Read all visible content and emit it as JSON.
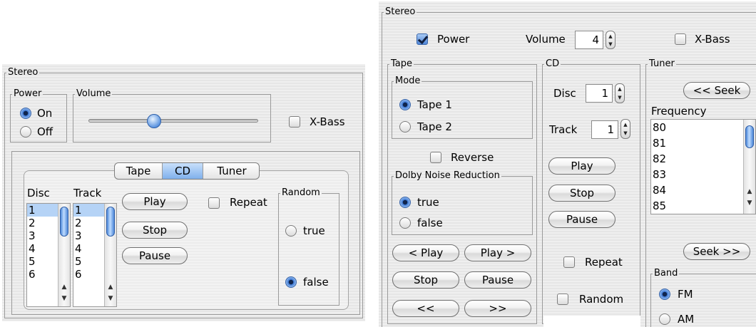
{
  "left": {
    "stereo_title": "Stereo",
    "power": {
      "title": "Power",
      "on_label": "On",
      "off_label": "Off",
      "selected": "On"
    },
    "volume": {
      "title": "Volume",
      "level": 0.45
    },
    "xbass_label": "X-Bass",
    "tabs": [
      {
        "label": "Tape"
      },
      {
        "label": "CD",
        "active": true
      },
      {
        "label": "Tuner"
      }
    ],
    "disc_header": "Disc",
    "track_header": "Track",
    "disc_items": [
      "1",
      "2",
      "3",
      "4",
      "5",
      "6"
    ],
    "track_items": [
      "1",
      "2",
      "3",
      "4",
      "5",
      "6"
    ],
    "play": "Play",
    "stop": "Stop",
    "pause": "Pause",
    "repeat_label": "Repeat",
    "random": {
      "title": "Random",
      "true_label": "true",
      "false_label": "false",
      "selected": "false"
    }
  },
  "right": {
    "stereo_title": "Stereo",
    "power_label": "Power",
    "power_checked": true,
    "volume_label": "Volume",
    "volume_value": "4",
    "xbass_label": "X-Bass",
    "tape": {
      "title": "Tape",
      "mode_title": "Mode",
      "tape1": "Tape 1",
      "tape2": "Tape 2",
      "selected": "Tape 1",
      "reverse": "Reverse",
      "dolby_title": "Dolby Noise Reduction",
      "dolby_true": "true",
      "dolby_false": "false",
      "dolby_selected": "true",
      "play_back": "< Play",
      "play_fwd": "Play >",
      "stop": "Stop",
      "pause": "Pause",
      "rewind": "<<",
      "forward": ">>"
    },
    "cd": {
      "title": "CD",
      "disc_label": "Disc",
      "disc_value": "1",
      "track_label": "Track",
      "track_value": "1",
      "play": "Play",
      "stop": "Stop",
      "pause": "Pause",
      "repeat": "Repeat",
      "random": "Random"
    },
    "tuner": {
      "title": "Tuner",
      "seek_back": "<< Seek",
      "frequency_label": "Frequency",
      "frequencies": [
        "80",
        "81",
        "82",
        "83",
        "84",
        "85"
      ],
      "seek_fwd": "Seek >>",
      "band_title": "Band",
      "fm": "FM",
      "am": "AM",
      "band_selected": "FM"
    }
  }
}
